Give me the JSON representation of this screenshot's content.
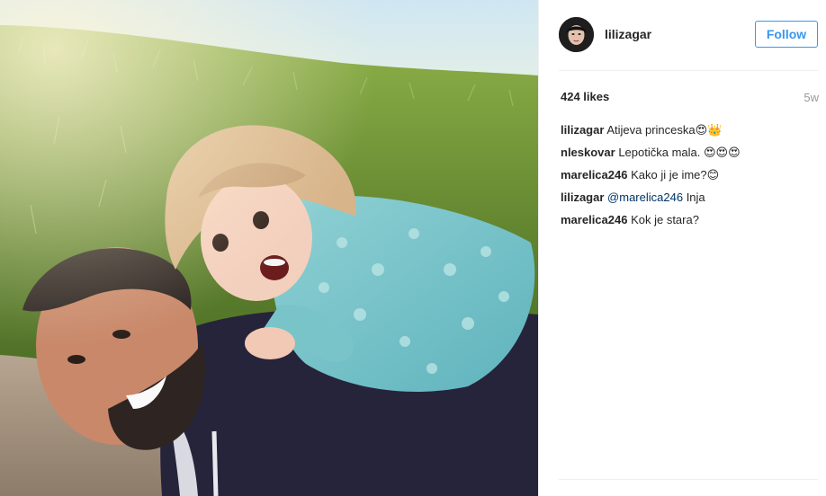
{
  "post": {
    "photo": {
      "description_icon": "photo-subject"
    },
    "header": {
      "username": "lilizagar",
      "follow_label": "Follow"
    },
    "likes": "424 likes",
    "age": "5w",
    "comments": [
      {
        "user": "lilizagar",
        "text": "Atijeva princeska😍👑"
      },
      {
        "user": "nleskovar",
        "text": "Lepotička mala. 😍😍😍"
      },
      {
        "user": "marelica246",
        "text": "Kako ji je ime?😊"
      },
      {
        "user": "lilizagar",
        "mention": "@marelica246",
        "text": "Inja"
      },
      {
        "user": "marelica246",
        "text": "Kok je stara?"
      }
    ]
  },
  "colors": {
    "accent": "#3897f0",
    "mention": "#003569",
    "text": "#262626",
    "muted": "#999999"
  }
}
